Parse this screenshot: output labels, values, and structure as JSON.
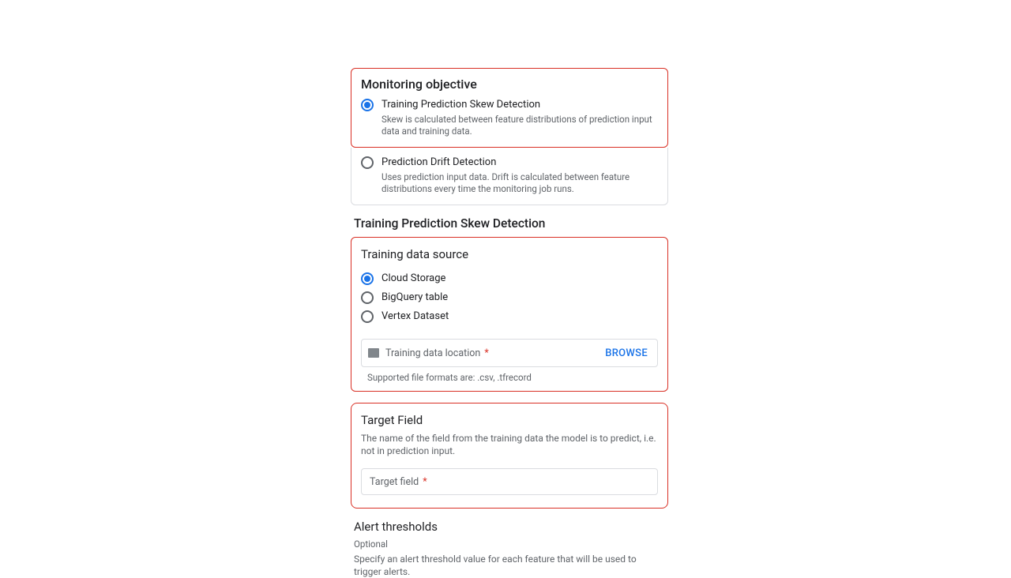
{
  "monitoring": {
    "title": "Monitoring objective",
    "options": [
      {
        "label": "Training Prediction Skew Detection",
        "desc": "Skew is calculated between feature distributions of prediction input data and training data.",
        "selected": true
      },
      {
        "label": "Prediction Drift Detection",
        "desc": "Uses prediction input data. Drift is calculated between feature distributions every time the monitoring job runs.",
        "selected": false
      }
    ]
  },
  "section_heading": "Training Prediction Skew Detection",
  "source": {
    "title": "Training data source",
    "options": [
      {
        "label": "Cloud Storage",
        "selected": true
      },
      {
        "label": "BigQuery table",
        "selected": false
      },
      {
        "label": "Vertex Dataset",
        "selected": false
      }
    ],
    "input_label": "Training data location",
    "browse": "BROWSE",
    "hint": "Supported file formats are: .csv, .tfrecord"
  },
  "target": {
    "title": "Target Field",
    "desc": "The name of the field from the training data the model is to predict, i.e. not in prediction input.",
    "input_label": "Target field"
  },
  "alerts": {
    "title": "Alert thresholds",
    "optional": "Optional",
    "desc": "Specify an alert threshold value for each feature that will be used to trigger alerts."
  }
}
